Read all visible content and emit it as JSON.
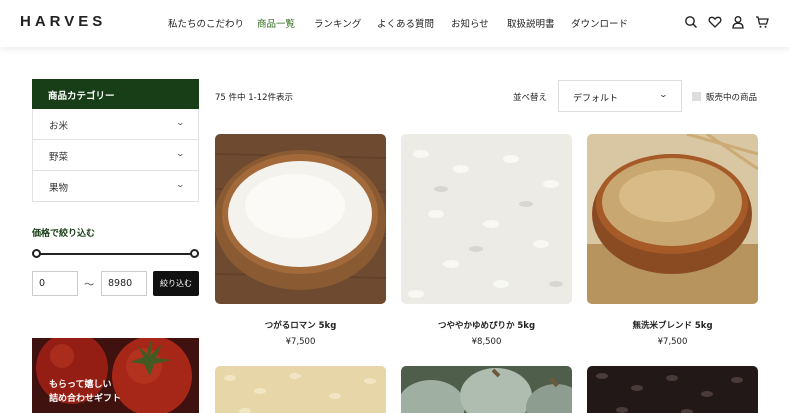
{
  "header": {
    "logo": "HARVES",
    "nav": [
      {
        "label": "私たちのこだわり",
        "active": false
      },
      {
        "label": "商品一覧",
        "active": true
      },
      {
        "label": "ランキング",
        "active": false
      },
      {
        "label": "よくある質問",
        "active": false
      },
      {
        "label": "お知らせ",
        "active": false
      },
      {
        "label": "取扱説明書",
        "active": false
      },
      {
        "label": "ダウンロード",
        "active": false
      }
    ],
    "icons": [
      "search-icon",
      "heart-icon",
      "user-icon",
      "cart-icon"
    ]
  },
  "sidebar": {
    "category_title": "商品カテゴリー",
    "categories": [
      {
        "label": "お米"
      },
      {
        "label": "野菜"
      },
      {
        "label": "果物"
      }
    ],
    "price_title": "価格で絞り込む",
    "price_min": "0",
    "price_separator": "〜",
    "price_max": "8980",
    "filter_button": "絞り込む",
    "banner_line1": "もらって嬉しい",
    "banner_line2": "詰め合わせギフト"
  },
  "toolbar": {
    "count": "75 件中 1-12件表示",
    "sort_label": "並べ替え",
    "sort_value": "デフォルト",
    "stock_label": "販売中の商品"
  },
  "products": [
    {
      "name": "つがるロマン 5kg",
      "price": "¥7,500",
      "image": "white-rice-in-wooden-bowl"
    },
    {
      "name": "つややかゆめぴりか 5kg",
      "price": "¥8,500",
      "image": "white-rice-closeup"
    },
    {
      "name": "無洗米ブレンド 5kg",
      "price": "¥7,500",
      "image": "brown-rice-in-wooden-bowl"
    }
  ],
  "products_row2": [
    {
      "image": "rice-grains"
    },
    {
      "image": "pumpkins"
    },
    {
      "image": "black-rice"
    }
  ],
  "colors": {
    "brand_green": "#173e17",
    "active_nav": "#2f6b1d"
  }
}
